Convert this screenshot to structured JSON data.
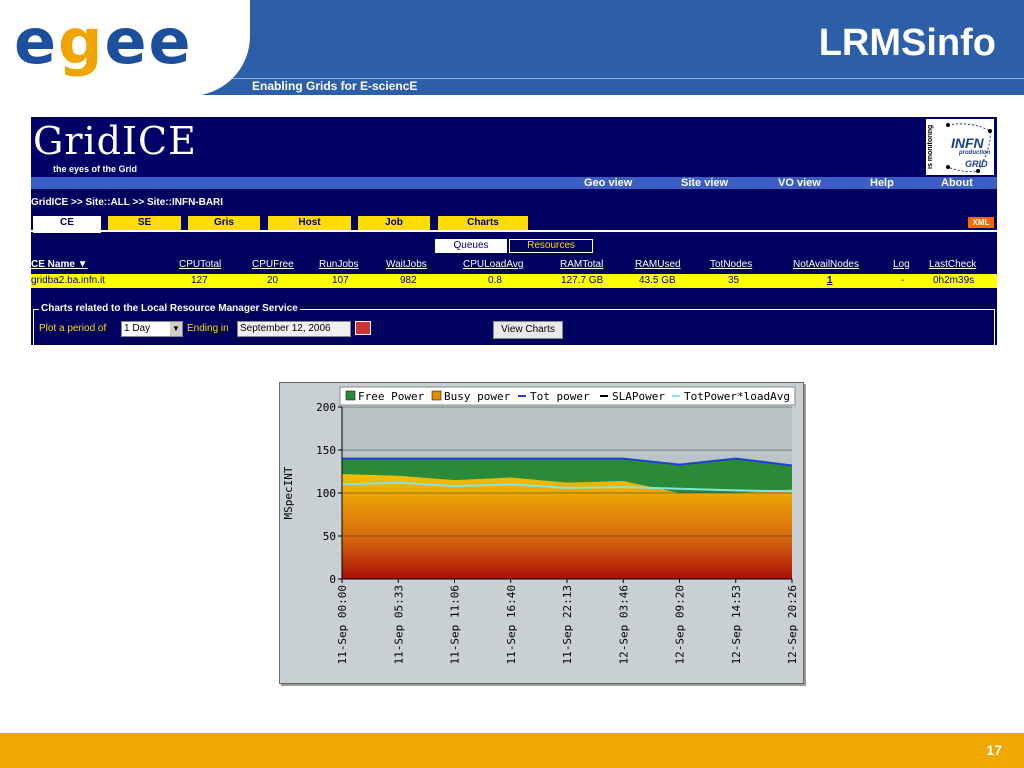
{
  "slide": {
    "title": "LRMSinfo",
    "logo_text": [
      "e",
      "g",
      "e",
      "e"
    ],
    "tagline": "Enabling Grids for E-sciencE",
    "page_number": "17",
    "colors": {
      "header_blue": "#2d5fa8",
      "footer_orange": "#f0a800",
      "logo_blue": "#1c4f9c",
      "logo_orange": "#f0a400"
    }
  },
  "gridice": {
    "logo_text": "GridICE",
    "logo_sub": "the eyes of the Grid",
    "partner": {
      "side_text": "is monitoring",
      "name": "INFN",
      "sub": "production",
      "grid": "GRID"
    },
    "nav": [
      "Geo view",
      "Site view",
      "VO view",
      "Help",
      "About"
    ],
    "breadcrumb": "GridICE >> Site::ALL >> Site::INFN-BARI",
    "tabs": [
      "CE",
      "SE",
      "Gris",
      "Host",
      "Job",
      "Charts"
    ],
    "active_tab": "CE",
    "xml_label": "XML",
    "view_toggles": [
      "Queues",
      "Resources"
    ],
    "table": {
      "headers": [
        "CE Name ▼",
        "CPUTotal",
        "CPUFree",
        "RunJobs",
        "WaitJobs",
        "CPULoadAvg",
        "RAMTotal",
        "RAMUsed",
        "TotNodes",
        "NotAvailNodes",
        "Log",
        "LastCheck"
      ],
      "rows": [
        [
          "gridba2.ba.infn.it",
          "127",
          "20",
          "107",
          "982",
          "0.8",
          "127.7 GB",
          "43.5 GB",
          "35",
          "1",
          "-",
          "0h2m39s"
        ]
      ]
    },
    "charts_form": {
      "legend": "Charts related to the Local Resource Manager Service",
      "plot_label": "Plot a period of",
      "period_value": "1 Day",
      "ending_label": "Ending in",
      "ending_value": "September 12, 2006",
      "button": "View Charts"
    }
  },
  "chart_data": {
    "type": "area",
    "title": "",
    "xlabel": "",
    "ylabel": "MSpecINT",
    "ylim": [
      0,
      200
    ],
    "yticks": [
      0,
      50,
      100,
      150,
      200
    ],
    "grid": true,
    "legend_position": "top",
    "x": [
      "11-Sep 00:00",
      "11-Sep 05:33",
      "11-Sep 11:06",
      "11-Sep 16:40",
      "11-Sep 22:13",
      "12-Sep 03:46",
      "12-Sep 09:20",
      "12-Sep 14:53",
      "12-Sep 20:26"
    ],
    "series": [
      {
        "name": "Free Power",
        "color": "#2a8a3a",
        "values": [
          18,
          20,
          25,
          22,
          28,
          26,
          33,
          40,
          28
        ]
      },
      {
        "name": "Busy power",
        "color": "#e08a00",
        "values": [
          122,
          120,
          115,
          118,
          112,
          114,
          100,
          100,
          104
        ]
      },
      {
        "name": "Tot power",
        "color": "#1f3fd0",
        "values": [
          140,
          140,
          140,
          140,
          140,
          140,
          133,
          140,
          132
        ]
      },
      {
        "name": "SLAPower",
        "color": "#000000",
        "values": [
          0,
          0,
          0,
          0,
          0,
          0,
          0,
          0,
          0
        ]
      },
      {
        "name": "TotPower*loadAvg",
        "color": "#7fe7e0",
        "values": [
          110,
          112,
          108,
          110,
          106,
          107,
          105,
          103,
          102
        ]
      }
    ]
  }
}
